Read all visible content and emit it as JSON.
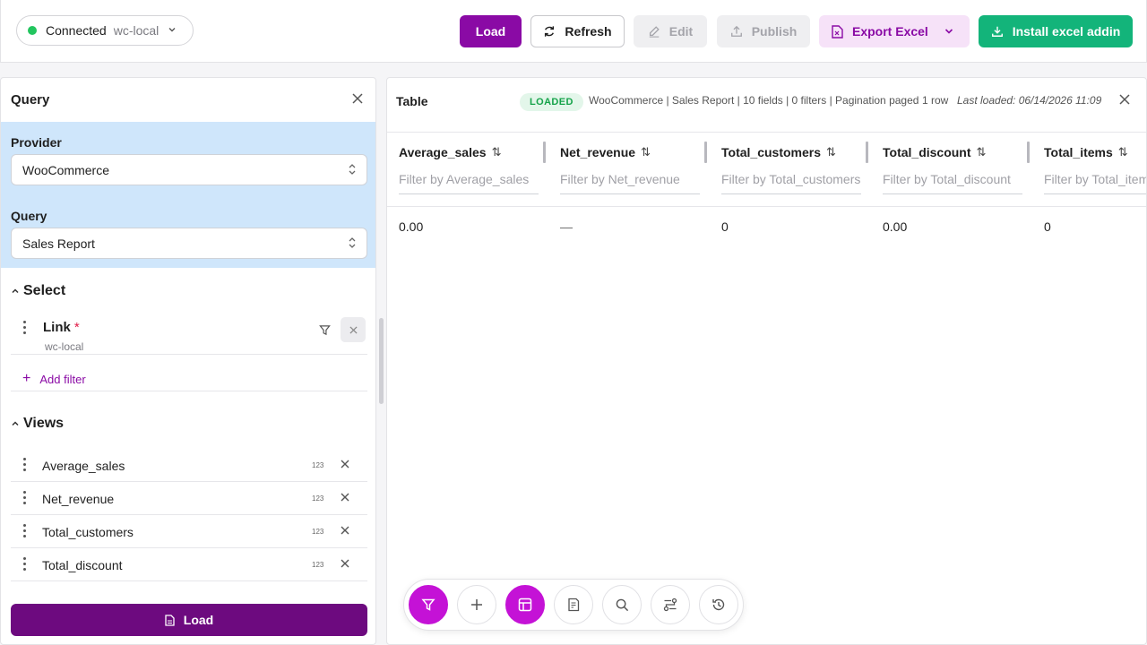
{
  "topbar": {
    "connection": {
      "status": "Connected",
      "name": "wc-local"
    },
    "load_label": "Load",
    "refresh_label": "Refresh",
    "edit_label": "Edit",
    "publish_label": "Publish",
    "export_label": "Export Excel",
    "install_label": "Install excel addin"
  },
  "query_panel": {
    "title": "Query",
    "provider_label": "Provider",
    "provider_value": "WooCommerce",
    "query_label": "Query",
    "query_value": "Sales Report",
    "select_section": "Select",
    "filter_item": {
      "name": "Link",
      "required_mark": "*",
      "value": "wc-local"
    },
    "add_filter_label": "Add filter",
    "views_section": "Views",
    "views": [
      {
        "name": "Average_sales",
        "type": "123"
      },
      {
        "name": "Net_revenue",
        "type": "123"
      },
      {
        "name": "Total_customers",
        "type": "123"
      },
      {
        "name": "Total_discount",
        "type": "123"
      }
    ],
    "load_label": "Load"
  },
  "table_panel": {
    "title": "Table",
    "status_badge": "LOADED",
    "meta": "WooCommerce | Sales Report | 10 fields | 0 filters | Pagination paged",
    "row_count": "1 row",
    "last_loaded": "Last loaded: 06/14/2026 11:09",
    "columns": [
      {
        "name": "Average_sales",
        "filter_placeholder": "Filter by Average_sales",
        "value": "0.00"
      },
      {
        "name": "Net_revenue",
        "filter_placeholder": "Filter by Net_revenue",
        "value": "—"
      },
      {
        "name": "Total_customers",
        "filter_placeholder": "Filter by Total_customers",
        "value": "0"
      },
      {
        "name": "Total_discount",
        "filter_placeholder": "Filter by Total_discount",
        "value": "0.00"
      },
      {
        "name": "Total_items",
        "filter_placeholder": "Filter by Total_items",
        "value": "0"
      }
    ]
  },
  "toolbar": {
    "buttons": [
      "filter-icon",
      "plus-icon",
      "table-icon",
      "report-icon",
      "search-icon",
      "flow-icon",
      "history-icon"
    ],
    "active": [
      "filter-icon",
      "table-icon"
    ]
  },
  "colors": {
    "primary": "#8a0aa5",
    "primary_dark": "#6d0a7f",
    "accent": "#c412d6",
    "success": "#13b47a",
    "connected": "#22c55e",
    "query_bg": "#cfe6fb"
  }
}
